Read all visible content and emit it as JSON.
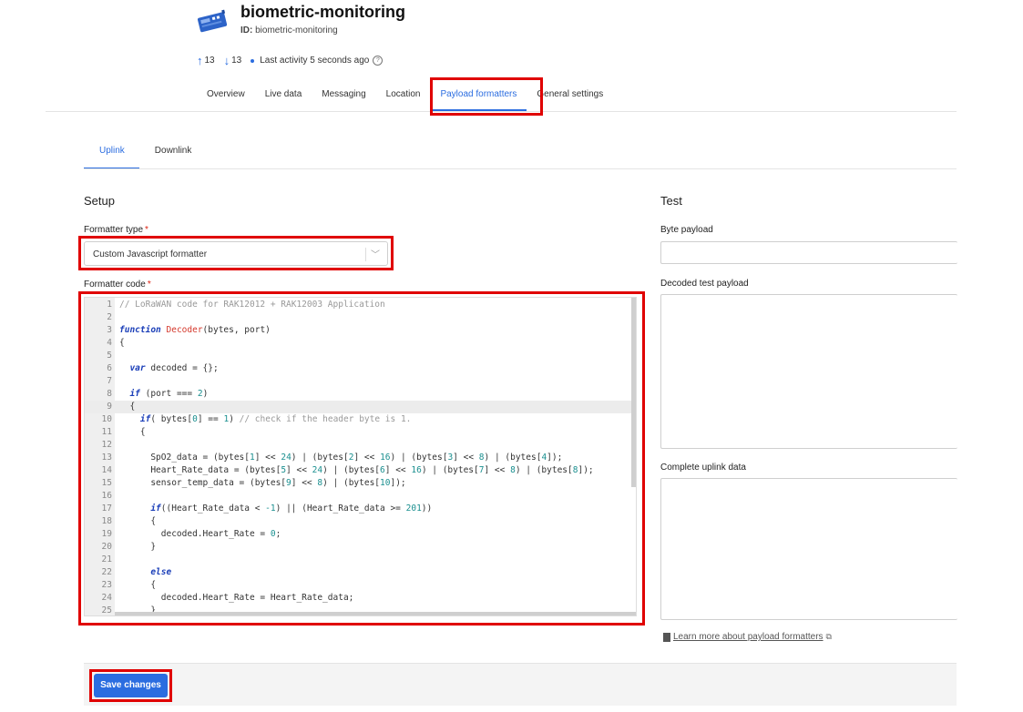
{
  "header": {
    "title": "biometric-monitoring",
    "id_label": "ID:",
    "id_value": "biometric-monitoring",
    "uplink_count": "13",
    "downlink_count": "13",
    "last_activity": "Last activity 5 seconds ago"
  },
  "nav": {
    "tabs": [
      "Overview",
      "Live data",
      "Messaging",
      "Location",
      "Payload formatters",
      "General settings"
    ],
    "active": "Payload formatters"
  },
  "subtabs": {
    "uplink": "Uplink",
    "downlink": "Downlink",
    "active": "Uplink"
  },
  "setup": {
    "heading": "Setup",
    "formatter_type_label": "Formatter type",
    "formatter_type_value": "Custom Javascript formatter",
    "formatter_code_label": "Formatter code",
    "required_mark": "*"
  },
  "code_lines": [
    "// LoRaWAN code for RAK12012 + RAK12003 Application",
    "",
    "function Decoder(bytes, port)",
    "{",
    "",
    "  var decoded = {};",
    "",
    "  if (port === 2)",
    "  {",
    "    if( bytes[0] == 1) // check if the header byte is 1.",
    "    {",
    "",
    "      SpO2_data = (bytes[1] << 24) | (bytes[2] << 16) | (bytes[3] << 8) | (bytes[4]);",
    "      Heart_Rate_data = (bytes[5] << 24) | (bytes[6] << 16) | (bytes[7] << 8) | (bytes[8]);",
    "      sensor_temp_data = (bytes[9] << 8) | (bytes[10]);",
    "",
    "      if((Heart_Rate_data < -1) || (Heart_Rate_data >= 201))",
    "      {",
    "        decoded.Heart_Rate = 0;",
    "      }",
    "",
    "      else",
    "      {",
    "        decoded.Heart_Rate = Heart_Rate_data;",
    "      }"
  ],
  "test": {
    "heading": "Test",
    "byte_payload_label": "Byte payload",
    "decoded_label": "Decoded test payload",
    "complete_label": "Complete uplink data",
    "learn_more": "Learn more about payload formatters"
  },
  "footer": {
    "save_label": "Save changes"
  },
  "colors": {
    "accent": "#2b6de0",
    "highlight": "#e00000"
  },
  "icons": [
    "device-icon",
    "arrow-up-icon",
    "arrow-down-icon",
    "help-icon",
    "chevron-down-icon",
    "book-icon",
    "external-link-icon"
  ]
}
